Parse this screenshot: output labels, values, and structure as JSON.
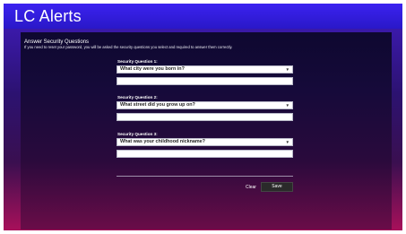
{
  "header": {
    "app_title": "LC Alerts"
  },
  "form": {
    "title": "Answer Security Questions",
    "description": "If you need to reset your password, you will be asked the security questions you select and required to answer them correctly.",
    "questions": [
      {
        "label": "Security Question 1:",
        "selected": "What city were you born in?",
        "answer": ""
      },
      {
        "label": "Security Question 2:",
        "selected": "What street did you grow up on?",
        "answer": ""
      },
      {
        "label": "Security Question 3:",
        "selected": "What was your childhood nickname?",
        "answer": ""
      }
    ],
    "clear_label": "Clear",
    "save_label": "Save"
  },
  "icons": {
    "dropdown": "chevron-down-icon"
  }
}
